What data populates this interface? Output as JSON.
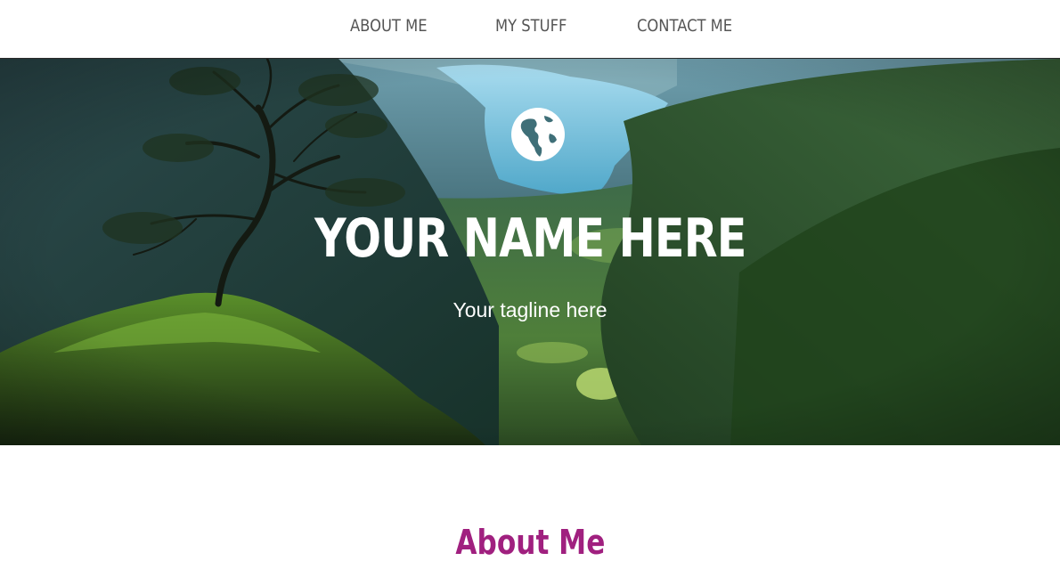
{
  "nav": {
    "items": [
      {
        "label": "ABOUT ME"
      },
      {
        "label": "MY STUFF"
      },
      {
        "label": "CONTACT ME"
      }
    ]
  },
  "hero": {
    "icon": "globe-icon",
    "title": "YOUR NAME HERE",
    "tagline": "Your tagline here"
  },
  "section": {
    "heading": "About Me"
  },
  "colors": {
    "accent": "#a0207f",
    "nav_text": "#555555",
    "hero_text": "#ffffff"
  }
}
